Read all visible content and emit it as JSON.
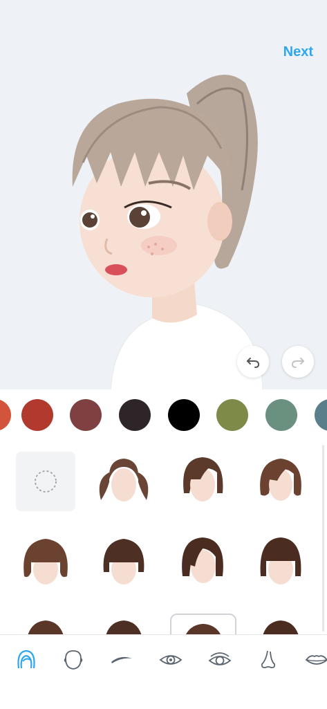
{
  "header": {
    "next_label": "Next"
  },
  "history": {
    "undo_icon": "undo-icon",
    "redo_icon": "redo-icon"
  },
  "colors": {
    "accent": "#2ea7ee",
    "swatches": [
      "#d2543a",
      "#b2392e",
      "#7e4040",
      "#2d2527",
      "#000000",
      "#7d8a48",
      "#6a9080",
      "#5a7e8a"
    ]
  },
  "hair_styles": [
    {
      "name": "none"
    },
    {
      "name": "twin-tails"
    },
    {
      "name": "side-part-bob"
    },
    {
      "name": "wavy-bob"
    },
    {
      "name": "wavy-bangs-bob"
    },
    {
      "name": "bangs-bob"
    },
    {
      "name": "sleek-bob"
    },
    {
      "name": "blunt-bangs-bob"
    },
    {
      "name": "partial-style-1"
    },
    {
      "name": "partial-style-2"
    },
    {
      "name": "partial-style-3-selected"
    },
    {
      "name": "partial-style-4"
    }
  ],
  "tabs": [
    {
      "icon": "hair-icon",
      "active": true
    },
    {
      "icon": "face-shape-icon",
      "active": false
    },
    {
      "icon": "eyebrow-icon",
      "active": false
    },
    {
      "icon": "eye-icon",
      "active": false
    },
    {
      "icon": "eye-detail-icon",
      "active": false
    },
    {
      "icon": "nose-icon",
      "active": false
    },
    {
      "icon": "lips-icon",
      "active": false
    }
  ]
}
